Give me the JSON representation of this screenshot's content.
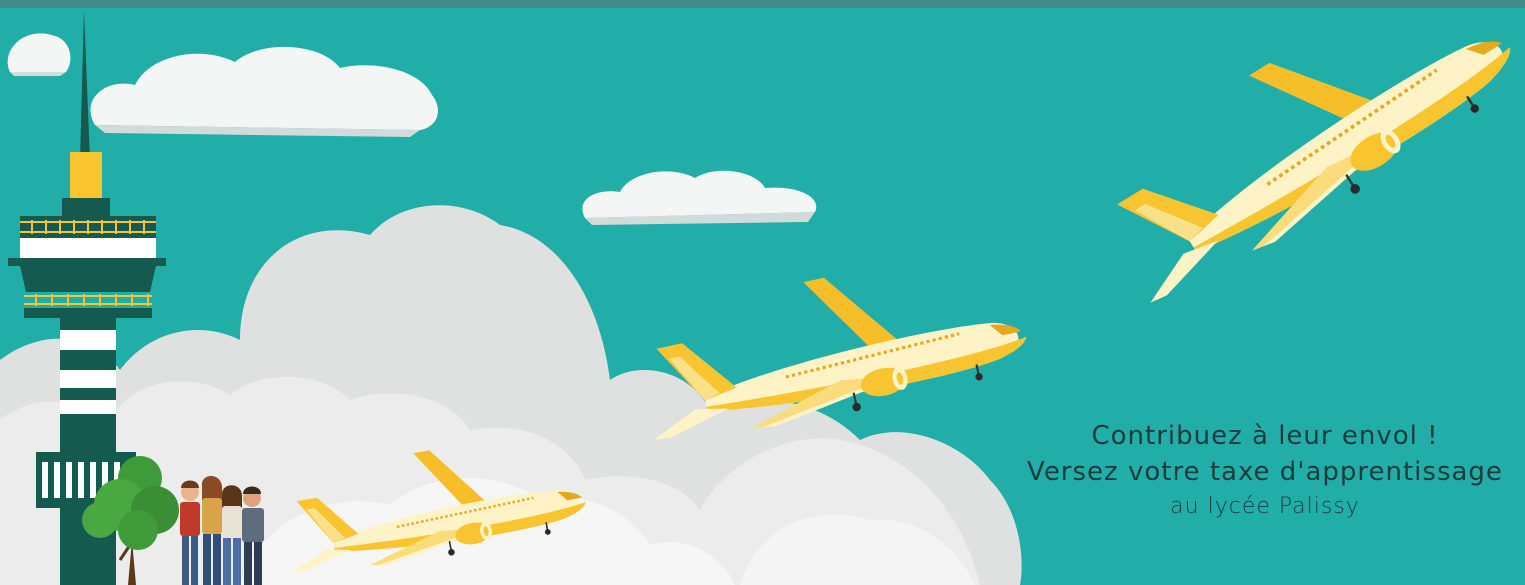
{
  "banner": {
    "headline": "Contribuez à leur envol !",
    "subline": "Versez votre taxe d'apprentissage",
    "school": "au lycée Palissy"
  },
  "colors": {
    "sky": "#22aea8",
    "topbar": "#3f8d86",
    "cloud_light": "#f2f3f3",
    "cloud_grey": "#dfe1e1",
    "tower_dark": "#145a4e",
    "plane_yellow": "#f8c531",
    "plane_cream": "#fdf3c7",
    "text": "#1f3b3b"
  }
}
